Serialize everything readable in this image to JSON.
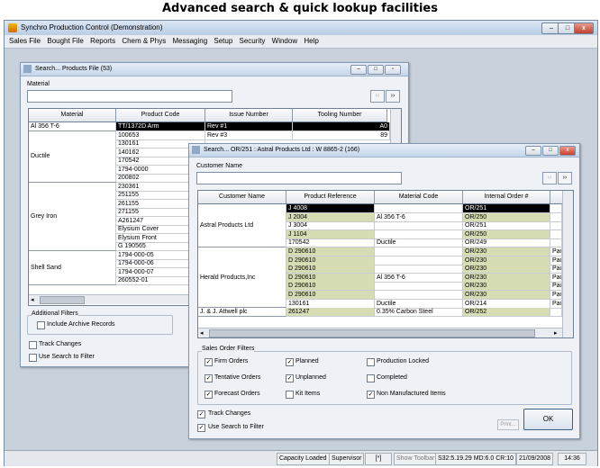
{
  "caption": "Advanced search & quick lookup facilities",
  "app": {
    "title": "Synchro Production Control (Demonstration)"
  },
  "menu": [
    "Sales File",
    "Bought File",
    "Reports",
    "Chem & Phys",
    "Messaging",
    "Setup",
    "Security",
    "Window",
    "Help"
  ],
  "win1": {
    "title": "Search... Products File (53)",
    "field_label": "Material",
    "columns": [
      "Material",
      "Product Code",
      "Issue Number",
      "Tooling Number"
    ],
    "first_row": {
      "material": "Al 356 T-6",
      "code": "TT/1372D Arm",
      "issue": "Rev #1",
      "tooling": "A0"
    },
    "second_row": {
      "code": "100653",
      "issue": "Rev #3",
      "tooling": "89"
    },
    "groups": [
      {
        "name": "Ductile",
        "codes": [
          "130161",
          "140162",
          "170542",
          "1794-0000",
          "200802"
        ]
      },
      {
        "name": "Grey Iron",
        "codes": [
          "230361",
          "251155",
          "261155",
          "271155",
          "A261247",
          "Elysium Cover",
          "Elysium Front",
          "G 190565"
        ]
      },
      {
        "name": "Shell Sand",
        "codes": [
          "1794-000-05",
          "1794-000-06",
          "1794-000-07",
          "260552-01"
        ]
      }
    ],
    "additional_filters": "Additional Filters",
    "include_archive": "Include Archive Records",
    "track_changes": "Track Changes",
    "use_search": "Use Search to Filter"
  },
  "win2": {
    "title": "Search... OR/251 : Astral Products Ltd : W 8865-2 (166)",
    "field_label": "Customer Name",
    "columns": [
      "Customer Name",
      "Product Reference",
      "Material Code",
      "Internal Order #"
    ],
    "groups": [
      {
        "customer": "Astral Products Ltd",
        "rows": [
          {
            "ref": "J 4008",
            "mat": "",
            "order": "OR/251",
            "sel": true
          },
          {
            "ref": "J 2004",
            "mat": "Al 356 T-6",
            "order": "OR/250"
          },
          {
            "ref": "J 3004",
            "mat": "",
            "order": "OR/251"
          },
          {
            "ref": "J 1104",
            "mat": "",
            "order": "OR/250"
          },
          {
            "ref": "170542",
            "mat": "Ductile",
            "order": "OR/249"
          }
        ]
      },
      {
        "customer": "Herald Products,Inc",
        "rows": [
          {
            "ref": "D 290610",
            "mat": "",
            "order": "OR/230",
            "extra": "Pac"
          },
          {
            "ref": "D 290610",
            "mat": "",
            "order": "OR/230",
            "extra": "Pac"
          },
          {
            "ref": "D 290610",
            "mat": "",
            "order": "OR/230",
            "extra": "Pac"
          },
          {
            "ref": "D 290610",
            "mat": "Al 356 T-6",
            "order": "OR/230",
            "extra": "Pac"
          },
          {
            "ref": "D 290610",
            "mat": "",
            "order": "OR/230",
            "extra": "Pac"
          },
          {
            "ref": "D 290610",
            "mat": "",
            "order": "OR/230",
            "extra": "Pac"
          },
          {
            "ref": "130161",
            "mat": "Ductile",
            "order": "OR/214",
            "extra": "Pac"
          }
        ]
      },
      {
        "customer": "J. & J. Attwell plc",
        "rows": [
          {
            "ref": "261247",
            "mat": "0.35% Carbon Steel",
            "order": "OR/252",
            "extra": ""
          }
        ]
      }
    ],
    "filters_title": "Sales Order Filters",
    "filters": [
      {
        "label": "Firm Orders",
        "checked": true
      },
      {
        "label": "Planned",
        "checked": true
      },
      {
        "label": "Production Locked",
        "checked": false
      },
      {
        "label": "Tentative Orders",
        "checked": true
      },
      {
        "label": "Unplanned",
        "checked": true
      },
      {
        "label": "Completed",
        "checked": false
      },
      {
        "label": "Forecast Orders",
        "checked": true
      },
      {
        "label": "Kit Items",
        "checked": false
      },
      {
        "label": "Non Manufactured Items",
        "checked": true
      }
    ],
    "track_changes": "Track Changes",
    "use_search": "Use Search to Filter",
    "print": "Print...",
    "ok": "OK"
  },
  "status": {
    "capacity": "Capacity Loaded",
    "user": "Supervisor",
    "flag": "[*]",
    "toolbar": "Show Toolbar",
    "info": "S32:5.19.29 MD:6.0 CR:10",
    "date": "21/09/2008",
    "time": "14:36"
  }
}
